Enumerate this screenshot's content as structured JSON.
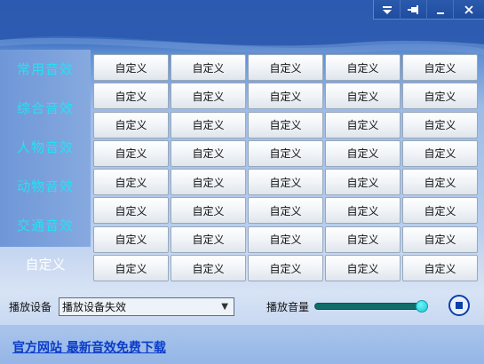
{
  "titlebar": {
    "buttons": [
      {
        "name": "menu-dropdown",
        "glyph": "▼"
      },
      {
        "name": "pin",
        "glyph": "📌"
      },
      {
        "name": "minimize",
        "glyph": "_"
      },
      {
        "name": "close",
        "glyph": "×"
      }
    ]
  },
  "sidebar": {
    "items": [
      {
        "label": "常用音效"
      },
      {
        "label": "综合音效"
      },
      {
        "label": "人物音效"
      },
      {
        "label": "动物音效"
      },
      {
        "label": "交通音效"
      },
      {
        "label": "自定义"
      }
    ],
    "active_index": 5
  },
  "grid": {
    "rows": 8,
    "cols": 5,
    "cell_label": "自定义"
  },
  "controls": {
    "device_label": "播放设备",
    "device_value": "播放设备失效",
    "volume_label": "播放音量",
    "volume_level_percent": 95
  },
  "footer": {
    "link_text": "官方网站  最新音效免费下载"
  },
  "colors": {
    "sidebar_text": "#27e0f5",
    "link": "#0a3cc9",
    "slider": "#0f6d6a"
  }
}
